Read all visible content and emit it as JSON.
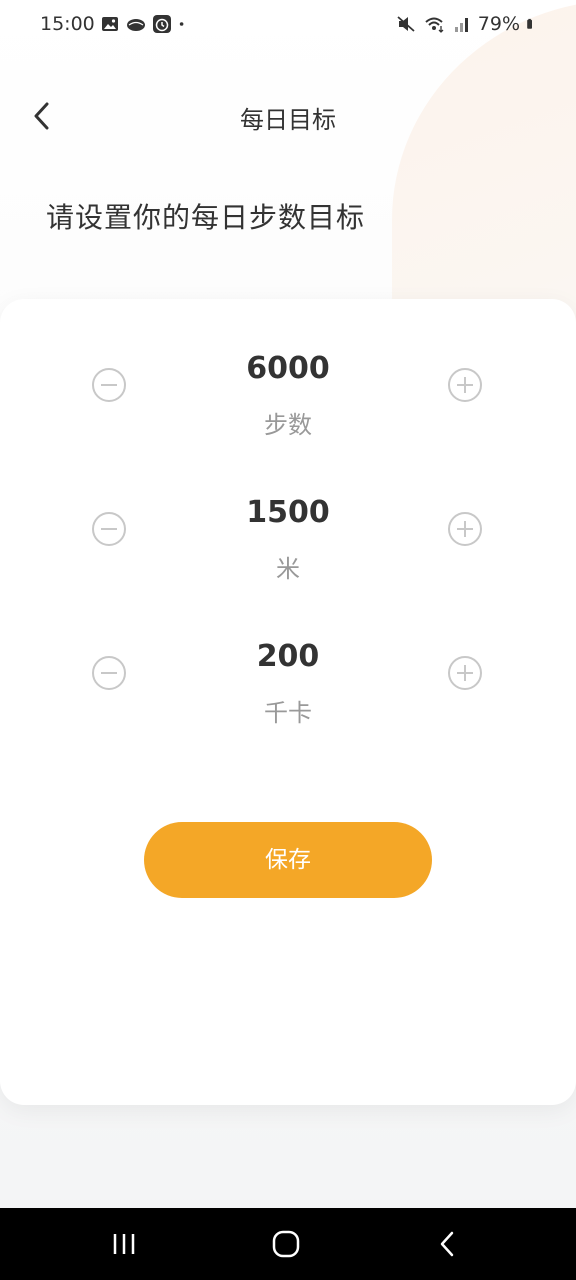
{
  "status_bar": {
    "time": "15:00",
    "battery": "79%",
    "icons_left": [
      "image-icon",
      "leaf-icon",
      "alarm-icon",
      "dot-icon"
    ],
    "icons_right": [
      "mute-icon",
      "wifi-icon",
      "signal-icon",
      "battery-icon"
    ]
  },
  "header": {
    "title": "每日目标",
    "back_icon": "chevron-left-icon"
  },
  "heading": "请设置你的每日步数目标",
  "goals": [
    {
      "value": "6000",
      "unit": "步数"
    },
    {
      "value": "1500",
      "unit": "米"
    },
    {
      "value": "200",
      "unit": "千卡"
    }
  ],
  "save_label": "保存",
  "nav": [
    "recent-apps-icon",
    "home-icon",
    "back-icon"
  ],
  "colors": {
    "accent": "#f4a727",
    "text": "#333333",
    "muted": "#999999"
  }
}
